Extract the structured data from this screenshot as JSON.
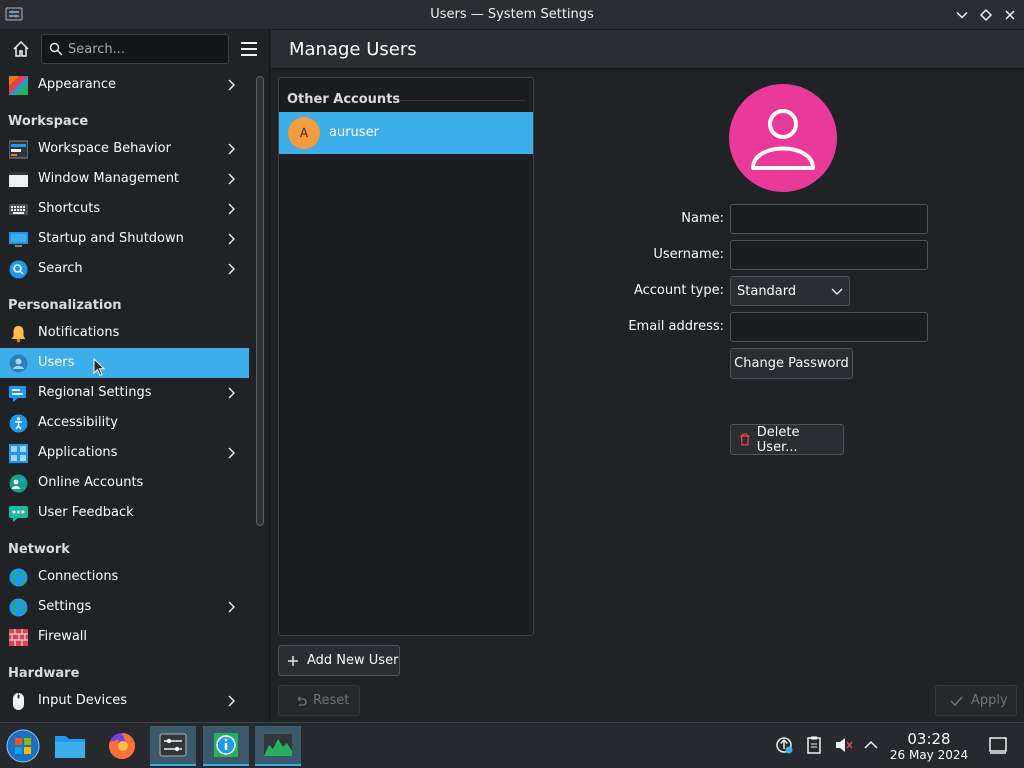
{
  "window": {
    "title": "Users — System Settings"
  },
  "sidebar": {
    "search_placeholder": "Search...",
    "appearance": "Appearance",
    "sections": {
      "workspace": "Workspace",
      "personalization": "Personalization",
      "network": "Network",
      "hardware": "Hardware"
    },
    "items": {
      "workspace_behavior": "Workspace Behavior",
      "window_management": "Window Management",
      "shortcuts": "Shortcuts",
      "startup": "Startup and Shutdown",
      "search": "Search",
      "notifications": "Notifications",
      "users": "Users",
      "regional": "Regional Settings",
      "accessibility": "Accessibility",
      "applications": "Applications",
      "online_accounts": "Online Accounts",
      "user_feedback": "User Feedback",
      "connections": "Connections",
      "settings": "Settings",
      "firewall": "Firewall",
      "input_devices": "Input Devices"
    }
  },
  "header": {
    "title": "Manage Users"
  },
  "accounts": {
    "section": "Other Accounts",
    "users": [
      {
        "initial": "A",
        "name": "auruser"
      }
    ]
  },
  "form": {
    "name_label": "Name:",
    "username_label": "Username:",
    "account_type_label": "Account type:",
    "account_type_value": "Standard",
    "email_label": "Email address:",
    "change_password": "Change Password",
    "delete_user": "Delete User..."
  },
  "buttons": {
    "add_user": "Add New User",
    "reset": "Reset",
    "apply": "Apply"
  },
  "taskbar": {
    "time": "03:28",
    "date": "26 May 2024"
  },
  "colors": {
    "accent": "#3daee9",
    "avatar_large": "#e93a9a",
    "avatar_small": "#f29b41"
  }
}
